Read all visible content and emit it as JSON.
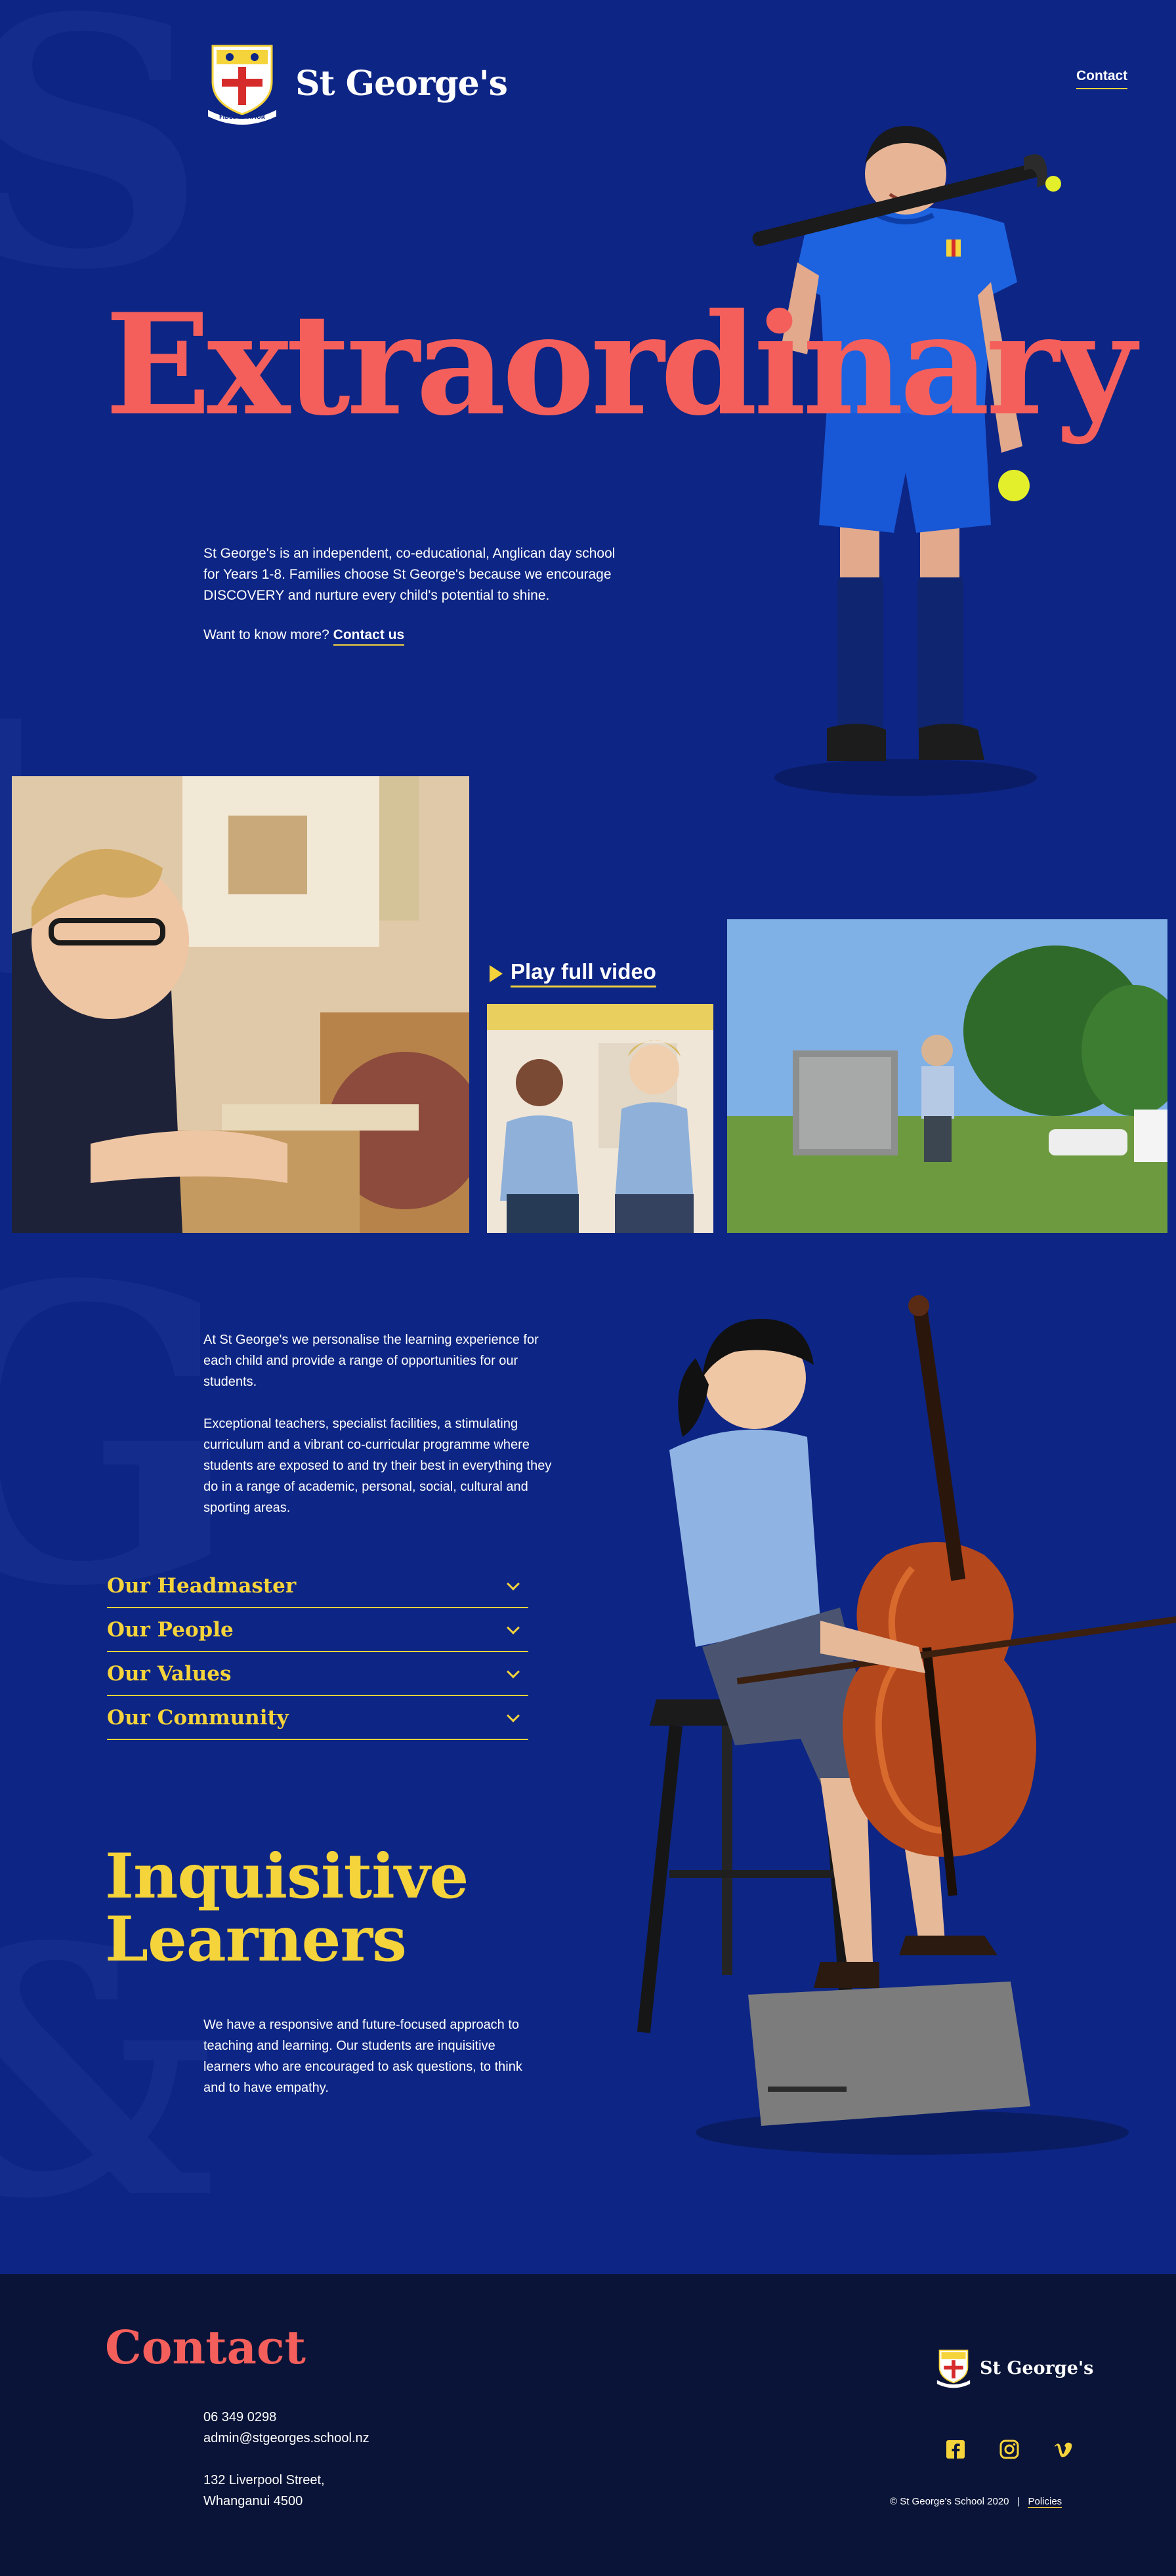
{
  "brand": {
    "name": "St George's",
    "crest_motto": "FIDES ET AMOR"
  },
  "header": {
    "contact_label": "Contact"
  },
  "hero": {
    "title": "Extraordinary",
    "intro": "St George's is an independent, co-educational, Anglican day school for Years 1-8. Families choose St George's because we encourage DISCOVERY and nurture every child's potential to shine.",
    "more_text": "Want to know more?",
    "more_link": "Contact us"
  },
  "gallery": {
    "play_label": "Play full video"
  },
  "learning": {
    "para1": "At St George's we personalise the learning experience for each child and provide a range of opportunities for our students.",
    "para2": "Exceptional teachers, specialist facilities, a stimulating curriculum and a vibrant co-curricular programme where students are exposed to and try their best in everything they do in a range of academic, personal, social, cultural and sporting areas.",
    "accordion": [
      {
        "label": "Our Headmaster"
      },
      {
        "label": "Our People"
      },
      {
        "label": "Our Values"
      },
      {
        "label": "Our Community"
      }
    ]
  },
  "inquisitive": {
    "title_line1": "Inquisitive",
    "title_line2": "Learners",
    "text": "We have a responsive and future-focused approach to teaching and learning. Our students are inquisitive learners who are encouraged to ask questions, to think and to have empathy."
  },
  "footer": {
    "title": "Contact",
    "phone": "06 349 0298",
    "email": "admin@stgeorges.school.nz",
    "address_line1": "132 Liverpool Street,",
    "address_line2": "Whanganui 4500",
    "copyright": "© St George's School 2020",
    "separator": "|",
    "policies_label": "Policies",
    "socials": [
      {
        "icon": "facebook-icon"
      },
      {
        "icon": "instagram-icon"
      },
      {
        "icon": "vimeo-icon"
      }
    ]
  },
  "colors": {
    "background": "#0d2584",
    "coral": "#f45f5c",
    "yellow": "#f5d33b",
    "footer": "#0a1438"
  }
}
